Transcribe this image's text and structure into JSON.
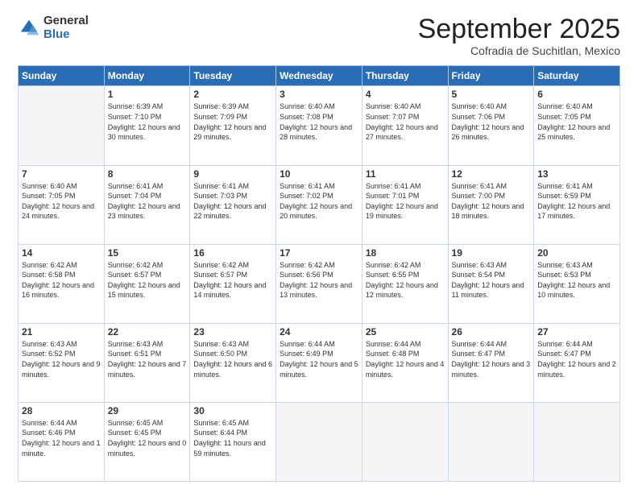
{
  "logo": {
    "general": "General",
    "blue": "Blue"
  },
  "header": {
    "month": "September 2025",
    "location": "Cofradia de Suchitlan, Mexico"
  },
  "days_header": [
    "Sunday",
    "Monday",
    "Tuesday",
    "Wednesday",
    "Thursday",
    "Friday",
    "Saturday"
  ],
  "weeks": [
    [
      {
        "day": "",
        "sunrise": "",
        "sunset": "",
        "daylight": ""
      },
      {
        "day": "1",
        "sunrise": "Sunrise: 6:39 AM",
        "sunset": "Sunset: 7:10 PM",
        "daylight": "Daylight: 12 hours and 30 minutes."
      },
      {
        "day": "2",
        "sunrise": "Sunrise: 6:39 AM",
        "sunset": "Sunset: 7:09 PM",
        "daylight": "Daylight: 12 hours and 29 minutes."
      },
      {
        "day": "3",
        "sunrise": "Sunrise: 6:40 AM",
        "sunset": "Sunset: 7:08 PM",
        "daylight": "Daylight: 12 hours and 28 minutes."
      },
      {
        "day": "4",
        "sunrise": "Sunrise: 6:40 AM",
        "sunset": "Sunset: 7:07 PM",
        "daylight": "Daylight: 12 hours and 27 minutes."
      },
      {
        "day": "5",
        "sunrise": "Sunrise: 6:40 AM",
        "sunset": "Sunset: 7:06 PM",
        "daylight": "Daylight: 12 hours and 26 minutes."
      },
      {
        "day": "6",
        "sunrise": "Sunrise: 6:40 AM",
        "sunset": "Sunset: 7:05 PM",
        "daylight": "Daylight: 12 hours and 25 minutes."
      }
    ],
    [
      {
        "day": "7",
        "sunrise": "Sunrise: 6:40 AM",
        "sunset": "Sunset: 7:05 PM",
        "daylight": "Daylight: 12 hours and 24 minutes."
      },
      {
        "day": "8",
        "sunrise": "Sunrise: 6:41 AM",
        "sunset": "Sunset: 7:04 PM",
        "daylight": "Daylight: 12 hours and 23 minutes."
      },
      {
        "day": "9",
        "sunrise": "Sunrise: 6:41 AM",
        "sunset": "Sunset: 7:03 PM",
        "daylight": "Daylight: 12 hours and 22 minutes."
      },
      {
        "day": "10",
        "sunrise": "Sunrise: 6:41 AM",
        "sunset": "Sunset: 7:02 PM",
        "daylight": "Daylight: 12 hours and 20 minutes."
      },
      {
        "day": "11",
        "sunrise": "Sunrise: 6:41 AM",
        "sunset": "Sunset: 7:01 PM",
        "daylight": "Daylight: 12 hours and 19 minutes."
      },
      {
        "day": "12",
        "sunrise": "Sunrise: 6:41 AM",
        "sunset": "Sunset: 7:00 PM",
        "daylight": "Daylight: 12 hours and 18 minutes."
      },
      {
        "day": "13",
        "sunrise": "Sunrise: 6:41 AM",
        "sunset": "Sunset: 6:59 PM",
        "daylight": "Daylight: 12 hours and 17 minutes."
      }
    ],
    [
      {
        "day": "14",
        "sunrise": "Sunrise: 6:42 AM",
        "sunset": "Sunset: 6:58 PM",
        "daylight": "Daylight: 12 hours and 16 minutes."
      },
      {
        "day": "15",
        "sunrise": "Sunrise: 6:42 AM",
        "sunset": "Sunset: 6:57 PM",
        "daylight": "Daylight: 12 hours and 15 minutes."
      },
      {
        "day": "16",
        "sunrise": "Sunrise: 6:42 AM",
        "sunset": "Sunset: 6:57 PM",
        "daylight": "Daylight: 12 hours and 14 minutes."
      },
      {
        "day": "17",
        "sunrise": "Sunrise: 6:42 AM",
        "sunset": "Sunset: 6:56 PM",
        "daylight": "Daylight: 12 hours and 13 minutes."
      },
      {
        "day": "18",
        "sunrise": "Sunrise: 6:42 AM",
        "sunset": "Sunset: 6:55 PM",
        "daylight": "Daylight: 12 hours and 12 minutes."
      },
      {
        "day": "19",
        "sunrise": "Sunrise: 6:43 AM",
        "sunset": "Sunset: 6:54 PM",
        "daylight": "Daylight: 12 hours and 11 minutes."
      },
      {
        "day": "20",
        "sunrise": "Sunrise: 6:43 AM",
        "sunset": "Sunset: 6:53 PM",
        "daylight": "Daylight: 12 hours and 10 minutes."
      }
    ],
    [
      {
        "day": "21",
        "sunrise": "Sunrise: 6:43 AM",
        "sunset": "Sunset: 6:52 PM",
        "daylight": "Daylight: 12 hours and 9 minutes."
      },
      {
        "day": "22",
        "sunrise": "Sunrise: 6:43 AM",
        "sunset": "Sunset: 6:51 PM",
        "daylight": "Daylight: 12 hours and 7 minutes."
      },
      {
        "day": "23",
        "sunrise": "Sunrise: 6:43 AM",
        "sunset": "Sunset: 6:50 PM",
        "daylight": "Daylight: 12 hours and 6 minutes."
      },
      {
        "day": "24",
        "sunrise": "Sunrise: 6:44 AM",
        "sunset": "Sunset: 6:49 PM",
        "daylight": "Daylight: 12 hours and 5 minutes."
      },
      {
        "day": "25",
        "sunrise": "Sunrise: 6:44 AM",
        "sunset": "Sunset: 6:48 PM",
        "daylight": "Daylight: 12 hours and 4 minutes."
      },
      {
        "day": "26",
        "sunrise": "Sunrise: 6:44 AM",
        "sunset": "Sunset: 6:47 PM",
        "daylight": "Daylight: 12 hours and 3 minutes."
      },
      {
        "day": "27",
        "sunrise": "Sunrise: 6:44 AM",
        "sunset": "Sunset: 6:47 PM",
        "daylight": "Daylight: 12 hours and 2 minutes."
      }
    ],
    [
      {
        "day": "28",
        "sunrise": "Sunrise: 6:44 AM",
        "sunset": "Sunset: 6:46 PM",
        "daylight": "Daylight: 12 hours and 1 minute."
      },
      {
        "day": "29",
        "sunrise": "Sunrise: 6:45 AM",
        "sunset": "Sunset: 6:45 PM",
        "daylight": "Daylight: 12 hours and 0 minutes."
      },
      {
        "day": "30",
        "sunrise": "Sunrise: 6:45 AM",
        "sunset": "Sunset: 6:44 PM",
        "daylight": "Daylight: 11 hours and 59 minutes."
      },
      {
        "day": "",
        "sunrise": "",
        "sunset": "",
        "daylight": ""
      },
      {
        "day": "",
        "sunrise": "",
        "sunset": "",
        "daylight": ""
      },
      {
        "day": "",
        "sunrise": "",
        "sunset": "",
        "daylight": ""
      },
      {
        "day": "",
        "sunrise": "",
        "sunset": "",
        "daylight": ""
      }
    ]
  ]
}
